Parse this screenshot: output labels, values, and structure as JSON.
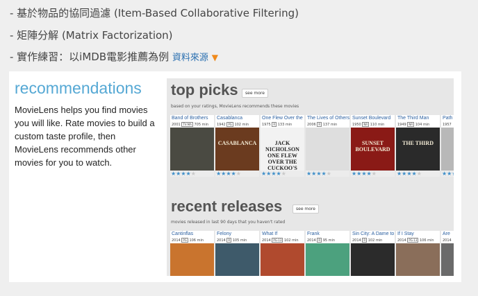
{
  "bullets": [
    {
      "text": "- 基於物品的協同過濾 (Item-Based Collaborative Filtering)"
    },
    {
      "text": "- 矩陣分解 (Matrix Factorization)"
    },
    {
      "text": "- 實作練習：以iMDB電影推薦為例",
      "link": "資料來源",
      "link_icon": "orange-down-triangle-icon"
    }
  ],
  "card": {
    "title": "recommendations",
    "description": "MovieLens helps you find movies you will like. Rate movies to build a custom taste profile, then MovieLens recommends other movies for you to watch."
  },
  "top_picks": {
    "title": "top picks",
    "see_more": "see more",
    "subtitle": "based on your ratings, MovieLens recommends these movies",
    "movies": [
      {
        "title": "Band of Brothers",
        "year": "2001",
        "rating": "TV-MA",
        "runtime": "705 min",
        "poster_color": "#4a4a42",
        "poster_text": "",
        "stars": 4
      },
      {
        "title": "Casablanca",
        "year": "1942",
        "rating": "PG",
        "runtime": "102 min",
        "poster_color": "#6b3b1f",
        "poster_text": "CASABLANCA",
        "stars": 4
      },
      {
        "title": "One Flew Over the Cuckoo's Nest",
        "year": "1975",
        "rating": "R",
        "runtime": "133 min",
        "poster_color": "#f2f2f2",
        "poster_text": "JACK NICHOLSON ONE FLEW OVER THE CUCKOO'S NEST",
        "stars": 4
      },
      {
        "title": "The Lives of Others",
        "year": "2006",
        "rating": "R",
        "runtime": "137 min",
        "poster_color": "#dedede",
        "poster_text": "",
        "stars": 4
      },
      {
        "title": "Sunset Boulevard",
        "year": "1950",
        "rating": "NR",
        "runtime": "110 min",
        "poster_color": "#8a1a16",
        "poster_text": "SUNSET BOULEVARD",
        "stars": 4
      },
      {
        "title": "The Third Man",
        "year": "1949",
        "rating": "NR",
        "runtime": "104 min",
        "poster_color": "#2a2a2a",
        "poster_text": "THE THIRD",
        "stars": 4
      },
      {
        "title": "Path",
        "year": "1957",
        "rating": "",
        "runtime": "",
        "poster_color": "#b8b8b8",
        "poster_text": "",
        "stars": 4
      }
    ]
  },
  "recent_releases": {
    "title": "recent releases",
    "see_more": "see more",
    "subtitle": "movies released in last 90 days that you haven't rated",
    "movies": [
      {
        "title": "Cantinflas",
        "year": "2014",
        "rating": "PG",
        "runtime": "106 min",
        "poster_color": "#c9742e"
      },
      {
        "title": "Felony",
        "year": "2014",
        "rating": "R",
        "runtime": "105 min",
        "poster_color": "#3e5a6a"
      },
      {
        "title": "What If",
        "year": "2014",
        "rating": "PG-13",
        "runtime": "102 min",
        "poster_color": "#b04a2e"
      },
      {
        "title": "Frank",
        "year": "2014",
        "rating": "R",
        "runtime": "95 min",
        "poster_color": "#4ca17e"
      },
      {
        "title": "Sin City: A Dame to Kill For",
        "year": "2014",
        "rating": "R",
        "runtime": "102 min",
        "poster_color": "#2b2b2b"
      },
      {
        "title": "If I Stay",
        "year": "2014",
        "rating": "PG-13",
        "runtime": "106 min",
        "poster_color": "#8a6e5a"
      },
      {
        "title": "Are",
        "year": "2014",
        "rating": "",
        "runtime": "",
        "poster_color": "#6a6a6a"
      }
    ]
  },
  "colors": {
    "accent_blue": "#55a8d4",
    "star_blue": "#3d8ec9",
    "link_blue": "#2a6fb0",
    "triangle_orange": "#f08a1c"
  }
}
